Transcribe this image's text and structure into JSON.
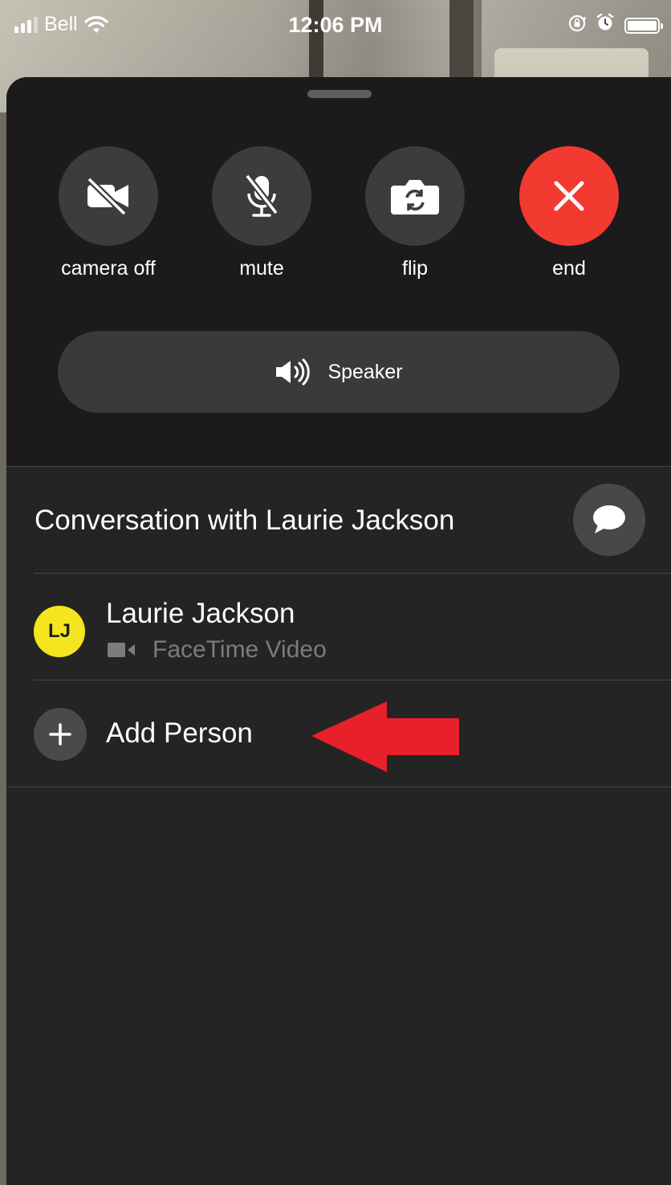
{
  "status_bar": {
    "carrier": "Bell",
    "time": "12:06 PM",
    "battery_level": 1.0
  },
  "controls": [
    {
      "id": "camera-off",
      "label": "camera off",
      "icon": "video-slash-icon"
    },
    {
      "id": "mute",
      "label": "mute",
      "icon": "mic-slash-icon"
    },
    {
      "id": "flip",
      "label": "flip",
      "icon": "camera-flip-icon"
    },
    {
      "id": "end",
      "label": "end",
      "icon": "close-icon",
      "color": "#f23a30"
    }
  ],
  "speaker": {
    "label": "Speaker",
    "icon": "speaker-icon"
  },
  "conversation": {
    "title": "Conversation with Laurie Jackson",
    "message_icon": "message-bubble-icon"
  },
  "participants": [
    {
      "initials": "LJ",
      "name": "Laurie Jackson",
      "status": "FaceTime Video",
      "avatar_color": "#f5e51e"
    }
  ],
  "add_person": {
    "label": "Add Person",
    "icon": "plus-icon"
  },
  "annotation": {
    "arrow_color": "#e8202a"
  }
}
